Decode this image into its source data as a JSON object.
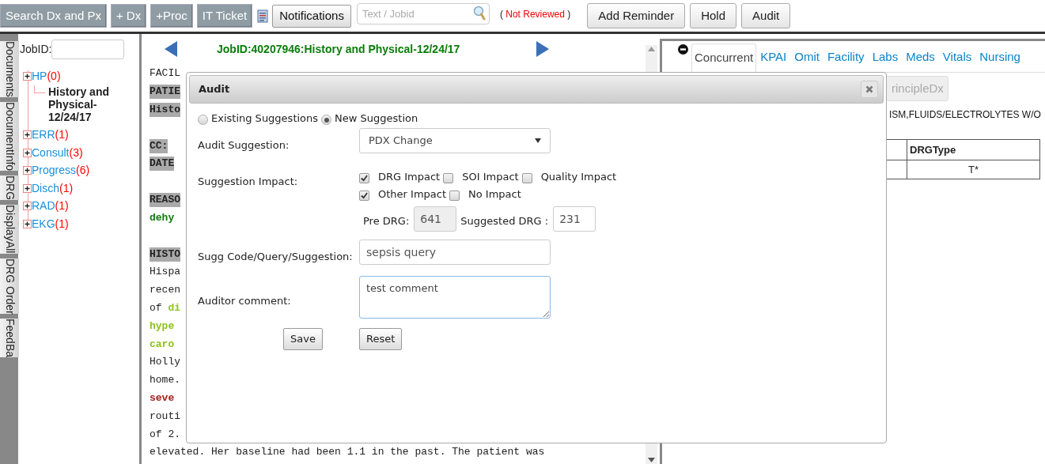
{
  "toolbar": {
    "actions": [
      {
        "label": "Search Dx and Px"
      },
      {
        "label": "+ Dx"
      },
      {
        "label": "+Proc"
      },
      {
        "label": "IT Ticket"
      }
    ],
    "notifications": "Notifications",
    "search": {
      "placeholder": "Text / Jobid"
    },
    "status": {
      "open": "(",
      "text": "Not Reviewed",
      "close": ")"
    },
    "right_buttons": [
      "Add Reminder",
      "Hold",
      "Audit"
    ]
  },
  "side_tabs": [
    "Documents",
    "DocumentInfo",
    "DRG",
    "DisplayAll",
    "DRG Order",
    "FeedBa"
  ],
  "tree": {
    "jobid_label": "JobID:",
    "items": [
      {
        "label": "HP",
        "count": "(0)",
        "children": [
          {
            "label": "History and Physical-12/24/17"
          }
        ]
      },
      {
        "label": "ERR",
        "count": "(1)"
      },
      {
        "label": "Consult",
        "count": "(3)"
      },
      {
        "label": "Progress",
        "count": "(6)"
      },
      {
        "label": "Disch",
        "count": "(1)"
      },
      {
        "label": "RAD",
        "count": "(1)"
      },
      {
        "label": "EKG",
        "count": "(1)"
      }
    ]
  },
  "document": {
    "title": "JobID:40207946:History and Physical-12/24/17",
    "lines": [
      {
        "kind": "text",
        "parts": [
          {
            "text": "FACIL",
            "kind": "plain"
          }
        ]
      },
      {
        "kind": "heading",
        "parts": [
          {
            "text": "PATIE",
            "kind": "plain"
          }
        ]
      },
      {
        "kind": "heading",
        "parts": [
          {
            "text": "Histo",
            "kind": "plain"
          }
        ]
      },
      {
        "kind": "blank"
      },
      {
        "kind": "heading",
        "parts": [
          {
            "text": "CC:",
            "kind": "plain"
          }
        ]
      },
      {
        "kind": "heading",
        "parts": [
          {
            "text": "DATE",
            "kind": "plain"
          }
        ]
      },
      {
        "kind": "blank"
      },
      {
        "kind": "heading",
        "parts": [
          {
            "text": "REASO",
            "kind": "plain"
          }
        ]
      },
      {
        "kind": "text",
        "parts": [
          {
            "text": "dehy",
            "kind": "reason"
          }
        ]
      },
      {
        "kind": "blank"
      },
      {
        "kind": "heading",
        "parts": [
          {
            "text": "HISTO",
            "kind": "plain"
          }
        ]
      },
      {
        "kind": "text",
        "parts": [
          {
            "text": "Hispa",
            "kind": "plain"
          }
        ]
      },
      {
        "kind": "text",
        "parts": [
          {
            "text": "recen",
            "kind": "plain"
          }
        ]
      },
      {
        "kind": "text",
        "parts": [
          {
            "text": "of ",
            "kind": "plain"
          },
          {
            "text": "di",
            "kind": "condition"
          }
        ]
      },
      {
        "kind": "text",
        "parts": [
          {
            "text": "hype",
            "kind": "condition"
          }
        ]
      },
      {
        "kind": "text",
        "parts": [
          {
            "text": "caro",
            "kind": "condition"
          }
        ]
      },
      {
        "kind": "text",
        "parts": [
          {
            "text": "Holly",
            "kind": "plain"
          }
        ]
      },
      {
        "kind": "text",
        "parts": [
          {
            "text": "home.",
            "kind": "plain"
          }
        ]
      },
      {
        "kind": "text",
        "parts": [
          {
            "text": "seve",
            "kind": "symptom"
          }
        ]
      },
      {
        "kind": "text",
        "parts": [
          {
            "text": "routi",
            "kind": "plain"
          }
        ]
      },
      {
        "kind": "text",
        "parts": [
          {
            "text": "of 2.",
            "kind": "plain"
          }
        ]
      },
      {
        "kind": "text",
        "parts": [
          {
            "text": "elevated. Her baseline had been 1.1 in the past. The patient was",
            "kind": "plain"
          }
        ]
      }
    ]
  },
  "right_panel": {
    "tabs": [
      {
        "label": "Concurrent",
        "selected": true
      },
      {
        "label": "KPAI",
        "selected": false
      },
      {
        "label": "Omit",
        "selected": false
      },
      {
        "label": "Facility",
        "selected": false
      },
      {
        "label": "Labs",
        "selected": false
      },
      {
        "label": "Meds",
        "selected": false
      },
      {
        "label": "Vitals",
        "selected": false
      },
      {
        "label": "Nursing",
        "selected": false
      }
    ],
    "principle_button": "rincipleDx",
    "drg_text": "ISM,FLUIDS/ELECTROLYTES W/O",
    "table": {
      "columns": [
        "DRGType"
      ],
      "rows": [
        [
          "T*"
        ]
      ]
    }
  },
  "modal": {
    "title": "Audit",
    "radios": [
      {
        "label": "Existing Suggestions",
        "selected": false
      },
      {
        "label": "New Suggestion",
        "selected": true
      }
    ],
    "audit_suggestion": {
      "label": "Audit Suggestion:",
      "value": "PDX Change"
    },
    "impact": {
      "label": "Suggestion Impact:",
      "rows": [
        [
          {
            "label": "DRG Impact",
            "checked": true
          },
          {
            "label": "SOI Impact",
            "checked": false
          },
          {
            "label": "Quality Impact",
            "checked": false
          }
        ],
        [
          {
            "label": "Other Impact",
            "checked": true
          },
          {
            "label": "No Impact",
            "checked": false
          }
        ]
      ],
      "pre_drg": {
        "label": "Pre DRG:",
        "value": "641"
      },
      "suggested_drg": {
        "label": "Suggested DRG :",
        "value": "231"
      }
    },
    "sugg_code": {
      "label": "Sugg Code/Query/Suggestion:",
      "value": "sepsis query"
    },
    "comment": {
      "label": "Auditor comment:",
      "value": "test comment"
    },
    "buttons": [
      "Save",
      "Reset"
    ]
  }
}
